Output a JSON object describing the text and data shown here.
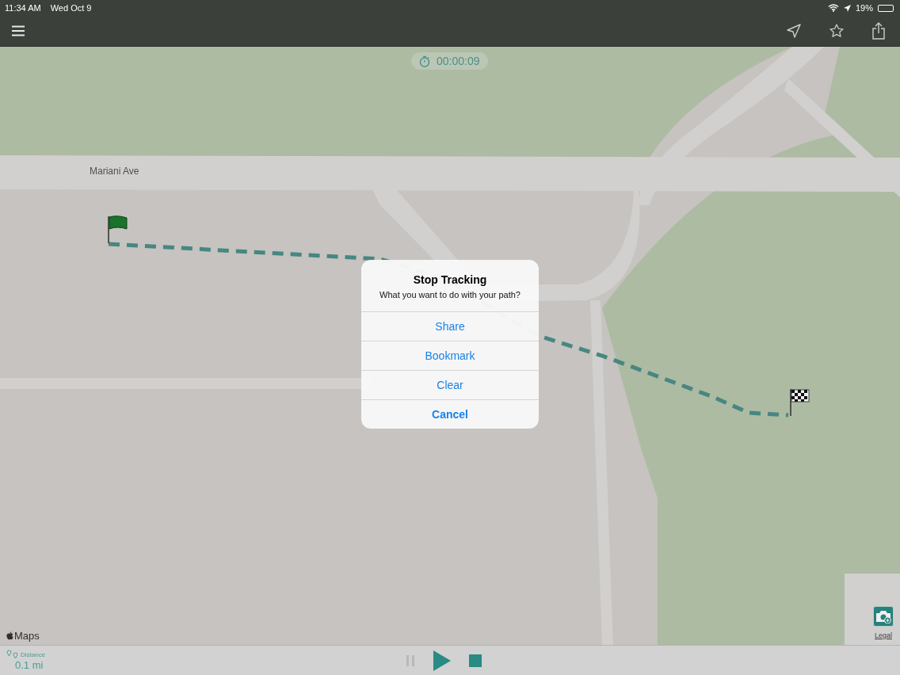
{
  "status_bar": {
    "time": "11:34 AM",
    "date": "Wed Oct 9",
    "battery": "19%"
  },
  "timer": "00:00:09",
  "map": {
    "street_label": "Mariani Ave",
    "attribution": "Maps",
    "legal": "Legal"
  },
  "alert": {
    "title": "Stop Tracking",
    "message": "What you want to do with your path?",
    "actions": [
      {
        "label": "Share",
        "kind": "default"
      },
      {
        "label": "Bookmark",
        "kind": "default"
      },
      {
        "label": "Clear",
        "kind": "default"
      },
      {
        "label": "Cancel",
        "kind": "cancel"
      }
    ]
  },
  "bottom_bar": {
    "distance_label": "Distance",
    "distance_value": "0.1 mi",
    "controls": [
      {
        "kind": "pause",
        "disabled": true
      },
      {
        "kind": "play",
        "disabled": false
      },
      {
        "kind": "stop",
        "disabled": false
      }
    ]
  }
}
